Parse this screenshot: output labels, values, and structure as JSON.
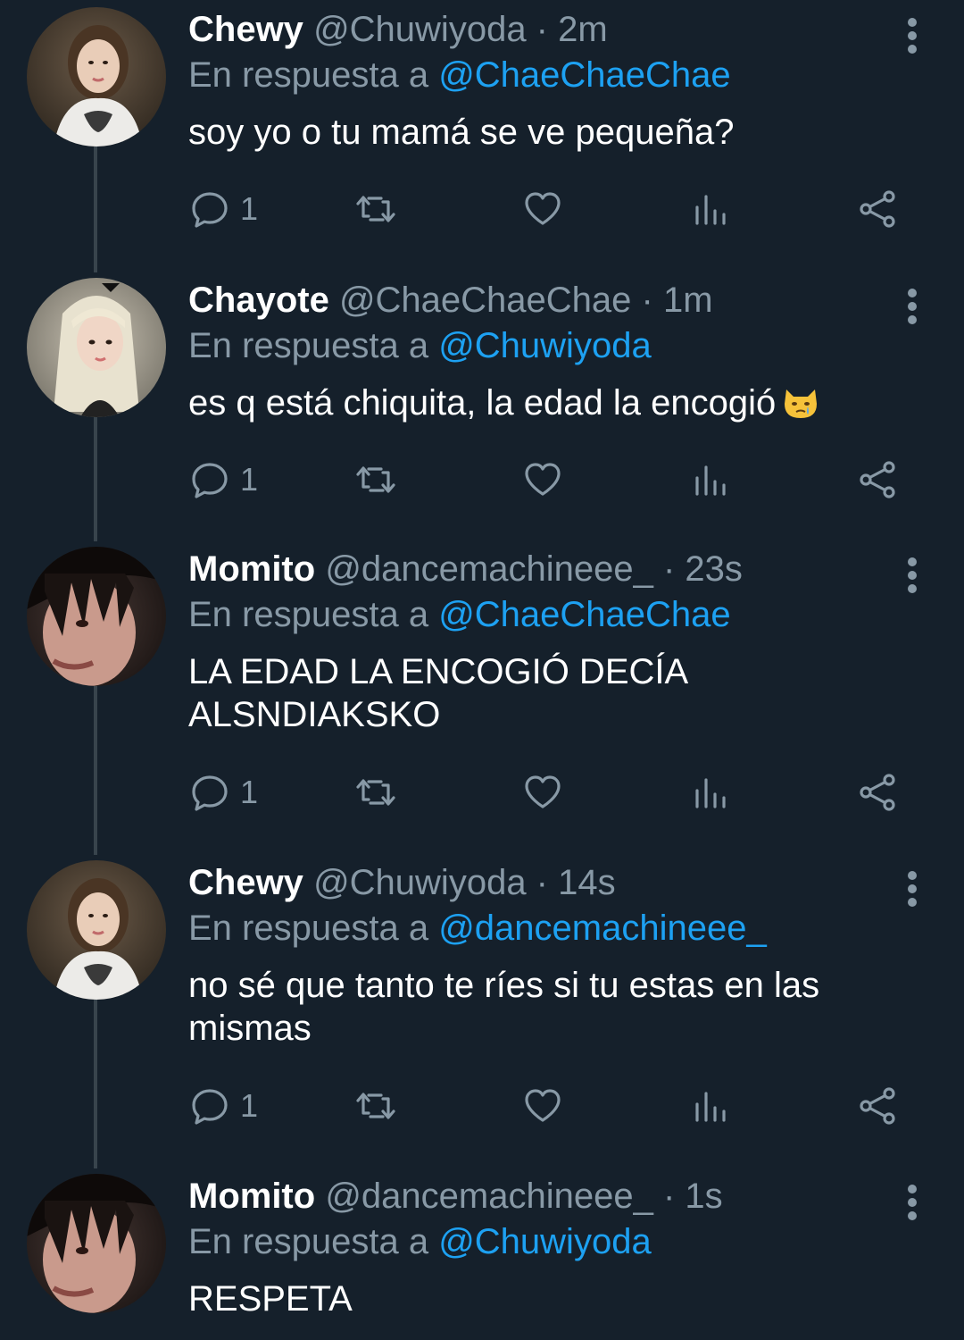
{
  "colors": {
    "background": "#15202b",
    "secondary": "#8899a6",
    "link": "#1da1f2",
    "thread_line": "#38444d"
  },
  "reply_prefix": "En respuesta a",
  "tweets": [
    {
      "name": "Chewy",
      "handle": "@Chuwiyoda",
      "time": "2m",
      "reply_to": "@ChaeChaeChae",
      "text": "soy yo o tu mamá se ve pequeña?",
      "replies": "1",
      "avatar": "chewy-avatar"
    },
    {
      "name": "Chayote",
      "handle": "@ChaeChaeChae",
      "time": "1m",
      "reply_to": "@Chuwiyoda",
      "text": "es q está chiquita, la edad la encogió",
      "emoji": "crying-cat-emoji",
      "replies": "1",
      "avatar": "chayote-avatar"
    },
    {
      "name": "Momito",
      "handle": "@dancemachineee_",
      "time": "23s",
      "reply_to": "@ChaeChaeChae",
      "text": "LA EDAD LA ENCOGIÓ DECÍA ALSNDIAKSKO",
      "replies": "1",
      "avatar": "momito-avatar"
    },
    {
      "name": "Chewy",
      "handle": "@Chuwiyoda",
      "time": "14s",
      "reply_to": "@dancemachineee_",
      "text": "no sé que tanto te ríes si tu estas en las mismas",
      "replies": "1",
      "avatar": "chewy-avatar"
    },
    {
      "name": "Momito",
      "handle": "@dancemachineee_",
      "time": "1s",
      "reply_to": "@Chuwiyoda",
      "text": "RESPETA",
      "avatar": "momito-avatar"
    }
  ]
}
